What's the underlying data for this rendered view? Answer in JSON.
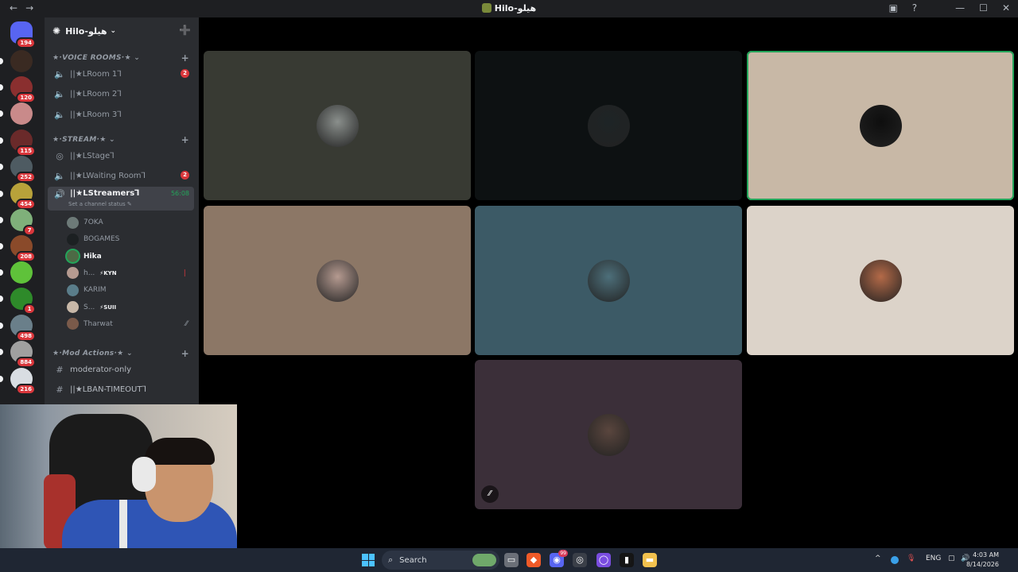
{
  "window": {
    "title": "Hilo-هيلو",
    "nav_back": "←",
    "nav_forward": "→",
    "icons": [
      "inbox-icon",
      "help-icon",
      "minimize-icon",
      "maximize-icon",
      "close-icon"
    ],
    "minimize": "—",
    "maximize": "☐",
    "close": "✕",
    "inbox": "▣",
    "help": "?"
  },
  "servers": [
    {
      "name": "discord-home",
      "badge": "194",
      "color": "#5865f2"
    },
    {
      "name": "server-1",
      "badge": "",
      "color": "#3a2a22"
    },
    {
      "name": "server-2",
      "badge": "120",
      "color": "#8a2f2f"
    },
    {
      "name": "server-3",
      "badge": "",
      "color": "#c98a8a"
    },
    {
      "name": "server-4",
      "badge": "115",
      "color": "#6a2a2a"
    },
    {
      "name": "server-5",
      "badge": "252",
      "color": "#4e5b62"
    },
    {
      "name": "server-6",
      "badge": "454",
      "color": "#b8a23a"
    },
    {
      "name": "server-7",
      "badge": "7",
      "color": "#7fb07a"
    },
    {
      "name": "server-8",
      "badge": "208",
      "color": "#8a4a2a"
    },
    {
      "name": "server-9",
      "badge": "",
      "color": "#5fc23a"
    },
    {
      "name": "server-10",
      "badge": "1",
      "color": "#2e8a2a"
    },
    {
      "name": "server-11",
      "badge": "498",
      "color": "#6a7f8a"
    },
    {
      "name": "server-12",
      "badge": "884",
      "color": "#a0a0a0"
    },
    {
      "name": "server-13",
      "badge": "216",
      "color": "#d9dde2"
    }
  ],
  "server_header": {
    "name": "Hilo-هيلو",
    "chevron": "⌄",
    "add_member": "➕"
  },
  "categories": {
    "voice_rooms": "★·VOICE ROOMS·★ ⌄",
    "stream": "★·STREAM·★ ⌄",
    "mod_actions": "★·Mod Actions·★ ⌄",
    "plus": "+"
  },
  "channels": {
    "room1": {
      "label": "||★LRoom 1⅂",
      "count": "2"
    },
    "room2": {
      "label": "||★LRoom 2⅂"
    },
    "room3": {
      "label": "||★LRoom 3⅂"
    },
    "stage": {
      "label": "||★LStage⅂"
    },
    "waiting": {
      "label": "||★LWaiting Room⅂",
      "count": "2"
    },
    "streamers": {
      "label": "||★LStreamers⅂",
      "timer": "56:08",
      "status": "Set a channel status ✎"
    },
    "moderator_only": {
      "label": "moderator-only"
    },
    "ban_timeout": {
      "label": "||★LBAN-TIMEOUT⅂"
    }
  },
  "voice_users": [
    {
      "name": "7OKA",
      "tag": "",
      "mark": "",
      "color": "#6d7a78"
    },
    {
      "name": "BOGAMES",
      "tag": "",
      "mark": "",
      "color": "#1c2022"
    },
    {
      "name": "Hika",
      "tag": "",
      "mark": "",
      "color": "#4d6a45",
      "speaking": true
    },
    {
      "name": "h...",
      "tag": "⚡KYN",
      "mark": "❘",
      "color": "#b59a90"
    },
    {
      "name": "KARIM",
      "tag": "",
      "mark": "",
      "color": "#5a7d8a"
    },
    {
      "name": "S...",
      "tag": "⚡SUII",
      "mark": "",
      "color": "#c8b8a8"
    },
    {
      "name": "Tharwat",
      "tag": "",
      "mark": "⁄⁄",
      "color": "#7a5a4a"
    }
  ],
  "tiles": [
    {
      "bg": "#383a33",
      "avatar": "#8a8f8c",
      "speaking": false
    },
    {
      "bg": "#0d1112",
      "avatar": "#1e2426",
      "speaking": false
    },
    {
      "bg": "#c8b8a6",
      "avatar": "#0e0e0e",
      "speaking": true
    },
    {
      "bg": "#8c7766",
      "avatar": "#b59a90",
      "speaking": false
    },
    {
      "bg": "#3c5a66",
      "avatar": "#4d6f7a",
      "speaking": false
    },
    {
      "bg": "#dcd3c9",
      "avatar": "#b46a48",
      "speaking": false
    },
    {
      "bg": "#3b2f39",
      "avatar": "#5a463e",
      "speaking": false,
      "muted": true
    }
  ],
  "mute_icon": "⁄⁄",
  "taskbar": {
    "search": "Search",
    "search_icon": "⌕",
    "apps": [
      {
        "name": "file-explorer-icon",
        "glyph": "▭",
        "color": "#6b6f78"
      },
      {
        "name": "brave-icon",
        "glyph": "◆",
        "color": "#f05a28"
      },
      {
        "name": "discord-taskbar-icon",
        "glyph": "◉",
        "color": "#5865f2",
        "badge": "99"
      },
      {
        "name": "obs-icon",
        "glyph": "◎",
        "color": "#3a3f48"
      },
      {
        "name": "circle-app-icon",
        "glyph": "◯",
        "color": "#7a4de0"
      },
      {
        "name": "capcut-icon",
        "glyph": "▮",
        "color": "#151515"
      },
      {
        "name": "folder-icon",
        "glyph": "▬",
        "color": "#f2c14e"
      }
    ],
    "tray": {
      "chevron": "^",
      "lang": "ENG",
      "mic": "🎙",
      "speaker": "🔊",
      "network": "▢"
    },
    "time": "4:03 AM",
    "date": "8/14/2026"
  }
}
